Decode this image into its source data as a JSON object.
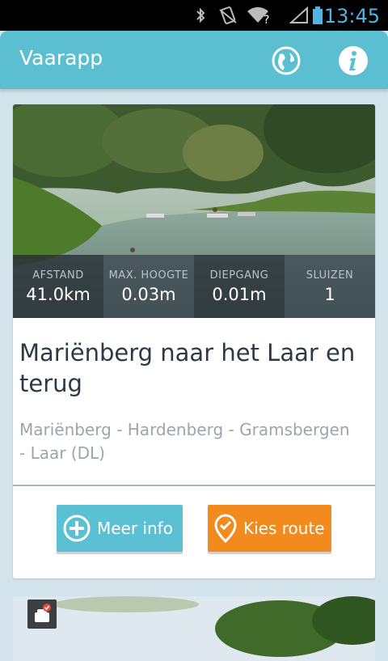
{
  "status_bar": {
    "time": "13:45"
  },
  "app": {
    "title": "Vaarapp"
  },
  "card": {
    "stats": [
      {
        "label": "AFSTAND",
        "value": "41.0km"
      },
      {
        "label": "MAX. HOOGTE",
        "value": "0.03m"
      },
      {
        "label": "DIEPGANG",
        "value": "0.01m"
      },
      {
        "label": "SLUIZEN",
        "value": "1"
      }
    ],
    "title": "Mariënberg naar het Laar en terug",
    "subtitle": "Mariënberg - Hardenberg - Gramsbergen - Laar (DL)",
    "buttons": {
      "info": "Meer info",
      "route": "Kies route"
    }
  },
  "colors": {
    "appbar": "#5bbfd1",
    "info_button": "#5bc0d3",
    "route_button": "#f28a1d",
    "status_time": "#4fb3e4"
  },
  "icons": [
    "bluetooth-icon",
    "vibrate-icon",
    "wifi-icon",
    "signal-icon",
    "battery-icon",
    "globe-icon",
    "info-icon",
    "plus-circle-icon",
    "map-pin-check-icon",
    "badge-icon"
  ]
}
